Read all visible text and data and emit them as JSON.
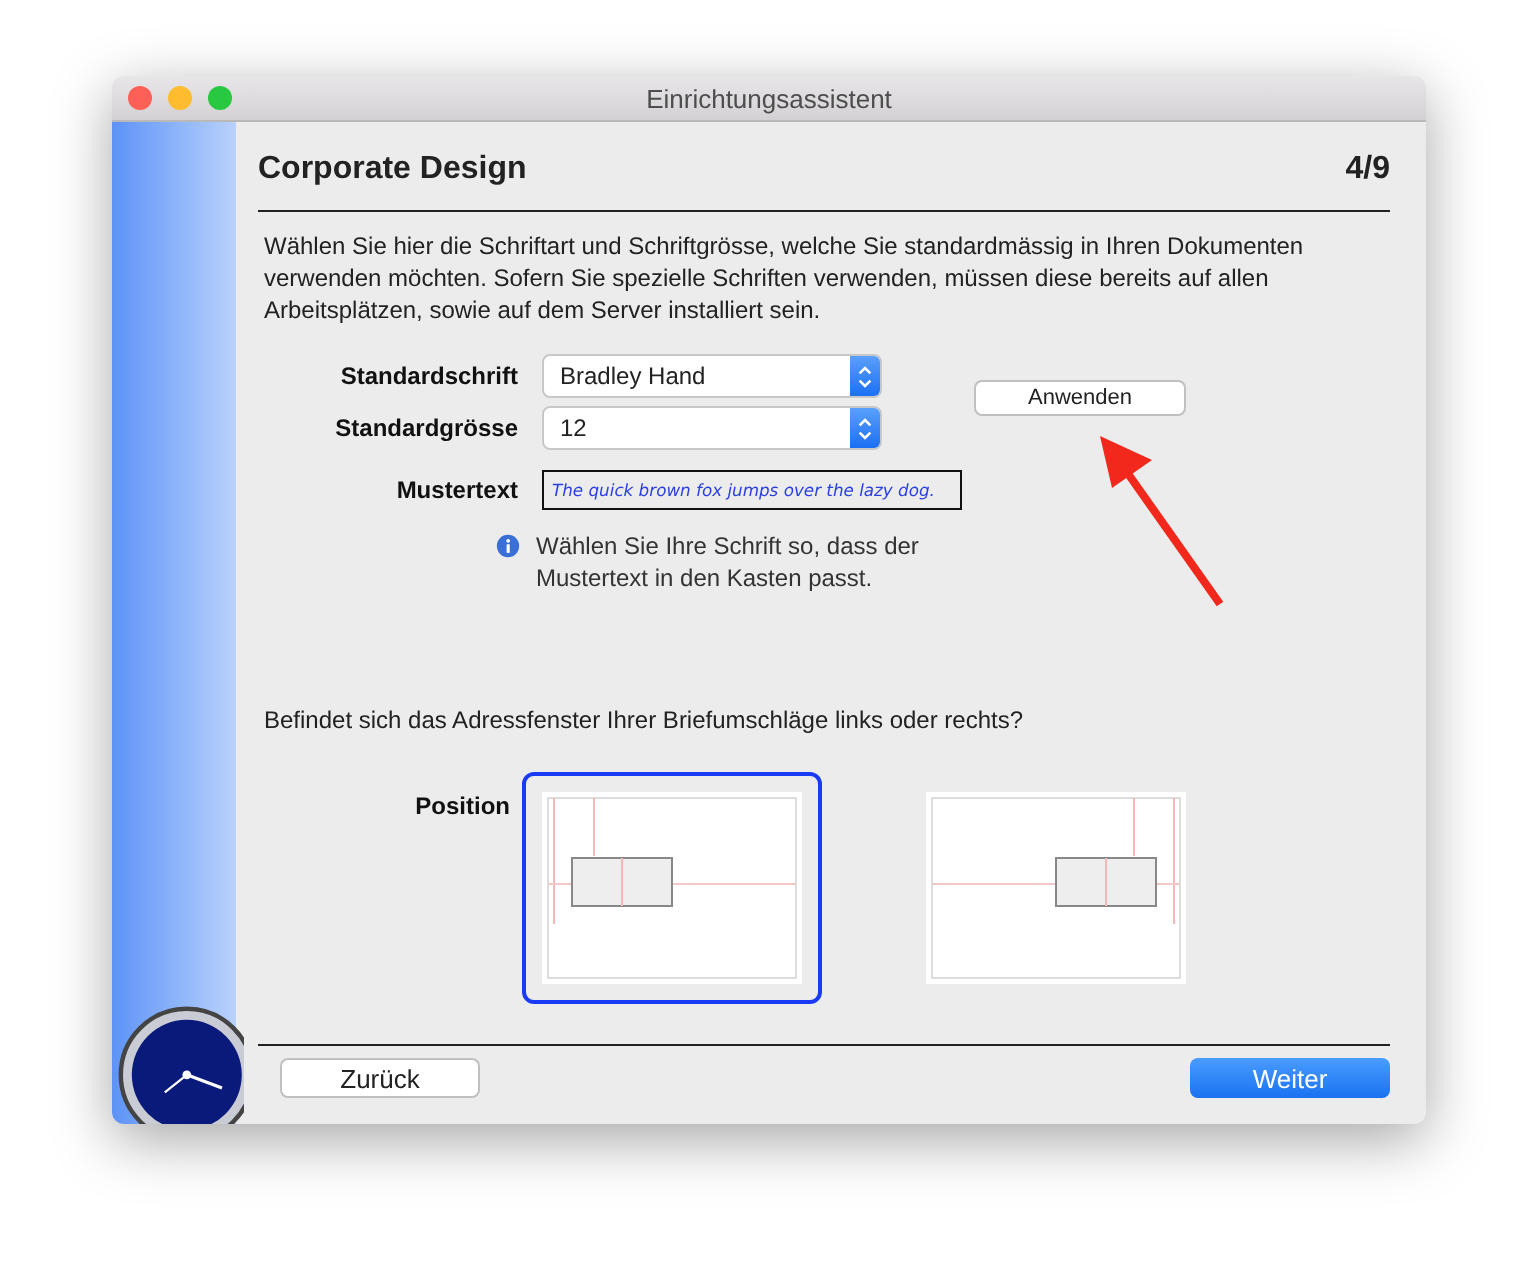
{
  "window": {
    "title": "Einrichtungsassistent"
  },
  "header": {
    "title": "Corporate Design",
    "step": "4/9"
  },
  "intro": "Wählen Sie hier die Schriftart und Schriftgrösse, welche Sie standardmässig in Ihren Dokumenten verwenden möchten. Sofern Sie spezielle Schriften verwenden, müssen diese bereits auf allen Arbeitsplätzen, sowie auf dem Server installiert sein.",
  "font": {
    "label": "Standardschrift",
    "value": "Bradley Hand"
  },
  "size": {
    "label": "Standardgrösse",
    "value": "12"
  },
  "sample": {
    "label": "Mustertext",
    "text": "The quick brown fox jumps over the lazy dog."
  },
  "apply_button": "Anwenden",
  "hint": "Wählen Sie Ihre Schrift so, dass der Mustertext in den Kasten passt.",
  "question": "Befindet sich das Adressfenster Ihrer Briefumschläge links oder rechts?",
  "position": {
    "label": "Position",
    "options": [
      {
        "kind": "left",
        "selected": true
      },
      {
        "kind": "right",
        "selected": false
      }
    ]
  },
  "buttons": {
    "back": "Zurück",
    "next": "Weiter"
  }
}
